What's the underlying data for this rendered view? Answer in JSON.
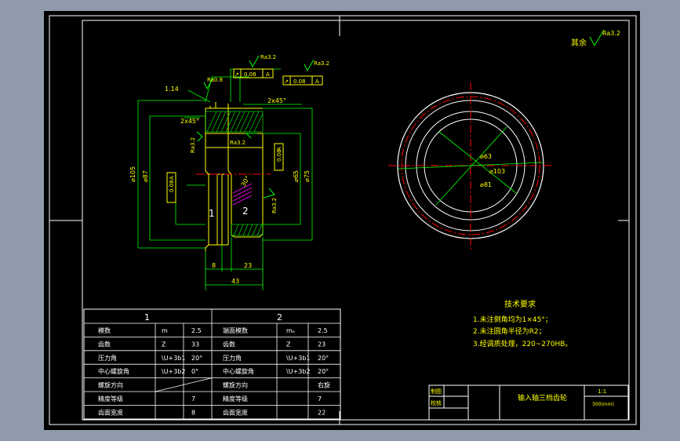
{
  "colors": {
    "outer_bg": "#8f9bab",
    "canvas": "#000000",
    "frame": "#ffffff",
    "gear_outline": "#ffff00",
    "dimension": "#00ff00",
    "centerline": "#ff0000",
    "hatch": "#ff00ff",
    "label": "#ffffff"
  },
  "roughness": {
    "top_right": "Ra3.2",
    "top_right_prefix": "其余",
    "sym1": "Ra0.8",
    "sym2": "Ra3.2",
    "sym3": "Ra3.2",
    "sym4": "Ra3.2",
    "sym5": "Ra3.2",
    "sym6": "Ra3.2"
  },
  "tolerance": {
    "t1_sym": "↗",
    "t1_val": "0.08",
    "t1_ref": "A",
    "t2_sym": "↗",
    "t2_val": "0.08",
    "t2_ref": "A",
    "t3_val": "0.08",
    "t3_ref": "A",
    "t4_val": "0.08",
    "t4_ref": "A"
  },
  "section_view": {
    "chamfer_left": "2x45°",
    "chamfer_right": "2x45°",
    "chamfer_top": "1.14",
    "dia_outer": "⌀105",
    "dia_mid": "⌀87",
    "dia_right1": "⌀75",
    "dia_right2": "⌀65",
    "angle": "30°",
    "part1_label": "1",
    "part2_label": "2",
    "dim_8": "8",
    "dim_23": "23",
    "dim_43": "43"
  },
  "circle_view": {
    "d1": "⌀63",
    "d2": "⌀103",
    "d3": "⌀81"
  },
  "tech_req": {
    "title": "技术要求",
    "items": [
      "1.未注倒角均为1×45°；",
      "2.未注圆角半径为R2；",
      "3.经调质处理，220~270HB。"
    ]
  },
  "gear_table": {
    "header_left": "1",
    "header_right": "2",
    "rows": [
      [
        "模数",
        "m",
        "2.5",
        "端面模数",
        "mₑ",
        "2.5"
      ],
      [
        "齿数",
        "Z",
        "33",
        "齿数",
        "Z",
        "23"
      ],
      [
        "压力角",
        "\\U+3b1",
        "20°",
        "压力角",
        "\\U+3b1",
        "20°"
      ],
      [
        "中心螺旋角",
        "\\U+3b2",
        "0°",
        "中心螺旋角",
        "\\U+3b2",
        "20°"
      ],
      [
        "螺旋方向",
        "",
        "",
        "螺旋方向",
        "",
        "右旋"
      ],
      [
        "精度等级",
        "",
        "7",
        "精度等级",
        "",
        "7"
      ],
      [
        "齿面宽度",
        "",
        "8",
        "齿面宽度",
        "",
        "22"
      ]
    ]
  },
  "title_block": {
    "drawn": "制图",
    "checked": "校核",
    "part_name": "输入轴三档齿轮",
    "scale": "1:1",
    "sheet": "300(mm)"
  }
}
